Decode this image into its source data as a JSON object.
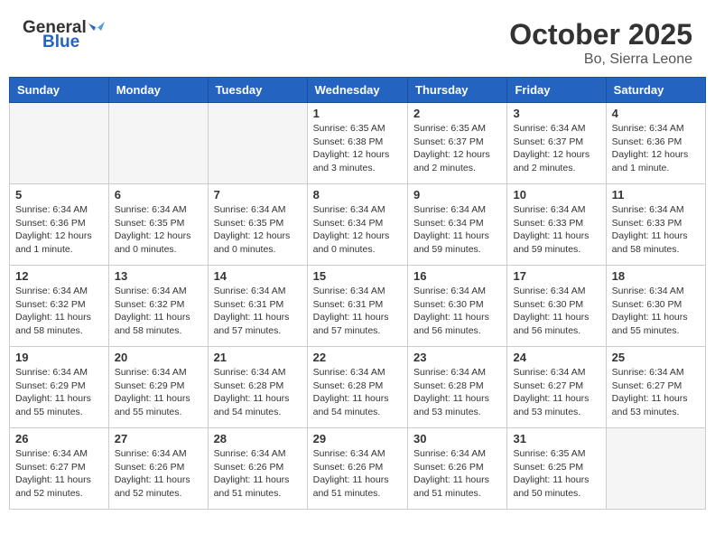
{
  "header": {
    "logo_general": "General",
    "logo_blue": "Blue",
    "month": "October 2025",
    "location": "Bo, Sierra Leone"
  },
  "weekdays": [
    "Sunday",
    "Monday",
    "Tuesday",
    "Wednesday",
    "Thursday",
    "Friday",
    "Saturday"
  ],
  "weeks": [
    [
      {
        "day": "",
        "info": ""
      },
      {
        "day": "",
        "info": ""
      },
      {
        "day": "",
        "info": ""
      },
      {
        "day": "1",
        "info": "Sunrise: 6:35 AM\nSunset: 6:38 PM\nDaylight: 12 hours\nand 3 minutes."
      },
      {
        "day": "2",
        "info": "Sunrise: 6:35 AM\nSunset: 6:37 PM\nDaylight: 12 hours\nand 2 minutes."
      },
      {
        "day": "3",
        "info": "Sunrise: 6:34 AM\nSunset: 6:37 PM\nDaylight: 12 hours\nand 2 minutes."
      },
      {
        "day": "4",
        "info": "Sunrise: 6:34 AM\nSunset: 6:36 PM\nDaylight: 12 hours\nand 1 minute."
      }
    ],
    [
      {
        "day": "5",
        "info": "Sunrise: 6:34 AM\nSunset: 6:36 PM\nDaylight: 12 hours\nand 1 minute."
      },
      {
        "day": "6",
        "info": "Sunrise: 6:34 AM\nSunset: 6:35 PM\nDaylight: 12 hours\nand 0 minutes."
      },
      {
        "day": "7",
        "info": "Sunrise: 6:34 AM\nSunset: 6:35 PM\nDaylight: 12 hours\nand 0 minutes."
      },
      {
        "day": "8",
        "info": "Sunrise: 6:34 AM\nSunset: 6:34 PM\nDaylight: 12 hours\nand 0 minutes."
      },
      {
        "day": "9",
        "info": "Sunrise: 6:34 AM\nSunset: 6:34 PM\nDaylight: 11 hours\nand 59 minutes."
      },
      {
        "day": "10",
        "info": "Sunrise: 6:34 AM\nSunset: 6:33 PM\nDaylight: 11 hours\nand 59 minutes."
      },
      {
        "day": "11",
        "info": "Sunrise: 6:34 AM\nSunset: 6:33 PM\nDaylight: 11 hours\nand 58 minutes."
      }
    ],
    [
      {
        "day": "12",
        "info": "Sunrise: 6:34 AM\nSunset: 6:32 PM\nDaylight: 11 hours\nand 58 minutes."
      },
      {
        "day": "13",
        "info": "Sunrise: 6:34 AM\nSunset: 6:32 PM\nDaylight: 11 hours\nand 58 minutes."
      },
      {
        "day": "14",
        "info": "Sunrise: 6:34 AM\nSunset: 6:31 PM\nDaylight: 11 hours\nand 57 minutes."
      },
      {
        "day": "15",
        "info": "Sunrise: 6:34 AM\nSunset: 6:31 PM\nDaylight: 11 hours\nand 57 minutes."
      },
      {
        "day": "16",
        "info": "Sunrise: 6:34 AM\nSunset: 6:30 PM\nDaylight: 11 hours\nand 56 minutes."
      },
      {
        "day": "17",
        "info": "Sunrise: 6:34 AM\nSunset: 6:30 PM\nDaylight: 11 hours\nand 56 minutes."
      },
      {
        "day": "18",
        "info": "Sunrise: 6:34 AM\nSunset: 6:30 PM\nDaylight: 11 hours\nand 55 minutes."
      }
    ],
    [
      {
        "day": "19",
        "info": "Sunrise: 6:34 AM\nSunset: 6:29 PM\nDaylight: 11 hours\nand 55 minutes."
      },
      {
        "day": "20",
        "info": "Sunrise: 6:34 AM\nSunset: 6:29 PM\nDaylight: 11 hours\nand 55 minutes."
      },
      {
        "day": "21",
        "info": "Sunrise: 6:34 AM\nSunset: 6:28 PM\nDaylight: 11 hours\nand 54 minutes."
      },
      {
        "day": "22",
        "info": "Sunrise: 6:34 AM\nSunset: 6:28 PM\nDaylight: 11 hours\nand 54 minutes."
      },
      {
        "day": "23",
        "info": "Sunrise: 6:34 AM\nSunset: 6:28 PM\nDaylight: 11 hours\nand 53 minutes."
      },
      {
        "day": "24",
        "info": "Sunrise: 6:34 AM\nSunset: 6:27 PM\nDaylight: 11 hours\nand 53 minutes."
      },
      {
        "day": "25",
        "info": "Sunrise: 6:34 AM\nSunset: 6:27 PM\nDaylight: 11 hours\nand 53 minutes."
      }
    ],
    [
      {
        "day": "26",
        "info": "Sunrise: 6:34 AM\nSunset: 6:27 PM\nDaylight: 11 hours\nand 52 minutes."
      },
      {
        "day": "27",
        "info": "Sunrise: 6:34 AM\nSunset: 6:26 PM\nDaylight: 11 hours\nand 52 minutes."
      },
      {
        "day": "28",
        "info": "Sunrise: 6:34 AM\nSunset: 6:26 PM\nDaylight: 11 hours\nand 51 minutes."
      },
      {
        "day": "29",
        "info": "Sunrise: 6:34 AM\nSunset: 6:26 PM\nDaylight: 11 hours\nand 51 minutes."
      },
      {
        "day": "30",
        "info": "Sunrise: 6:34 AM\nSunset: 6:26 PM\nDaylight: 11 hours\nand 51 minutes."
      },
      {
        "day": "31",
        "info": "Sunrise: 6:35 AM\nSunset: 6:25 PM\nDaylight: 11 hours\nand 50 minutes."
      },
      {
        "day": "",
        "info": ""
      }
    ]
  ]
}
